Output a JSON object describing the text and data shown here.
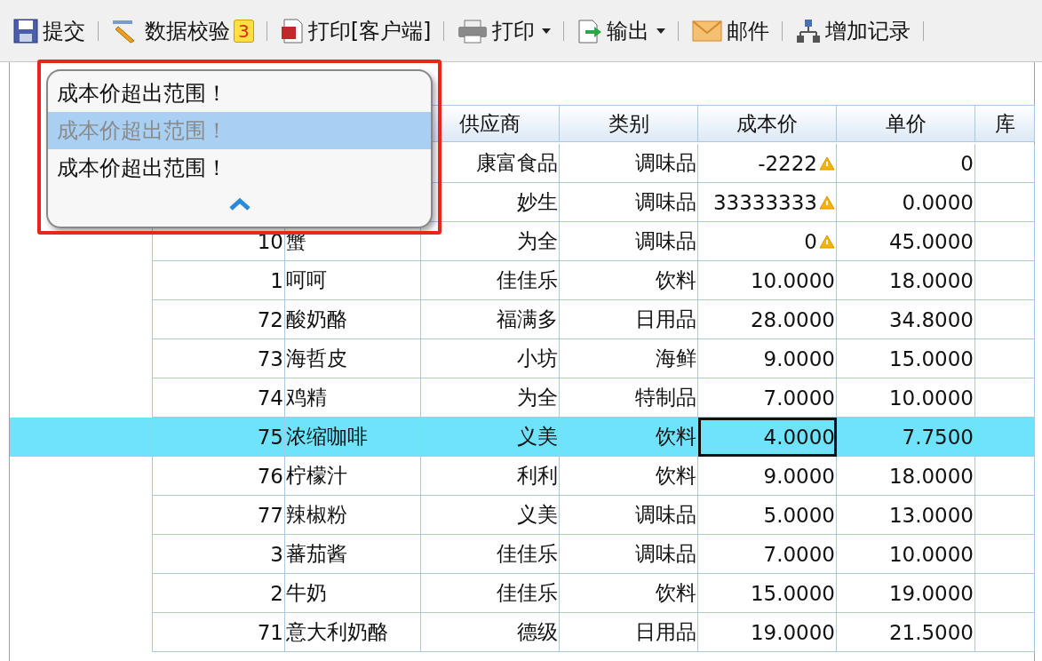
{
  "toolbar": [
    {
      "label": "提交",
      "dropdown": false
    },
    {
      "label": "数据校验",
      "badge": "3",
      "dropdown": false
    },
    {
      "label": "打印[客户端]",
      "dropdown": false
    },
    {
      "label": "打印",
      "dropdown": true
    },
    {
      "label": "输出",
      "dropdown": true
    },
    {
      "label": "邮件",
      "dropdown": false
    },
    {
      "label": "增加记录",
      "dropdown": false
    }
  ],
  "validation_popup": {
    "messages": [
      {
        "text": "成本价超出范围！",
        "selected": false
      },
      {
        "text": "成本价超出范围！",
        "selected": true
      },
      {
        "text": "成本价超出范围！",
        "selected": false
      }
    ]
  },
  "table": {
    "columns": [
      {},
      {},
      {
        "label": "供应商"
      },
      {
        "label": "类别"
      },
      {
        "label": "成本价"
      },
      {
        "label": "单价"
      },
      {
        "label": "库"
      }
    ],
    "rows": [
      {
        "supplier": "康富食品",
        "category": "调味品",
        "cost": "-2222",
        "price": "0",
        "cost_warning": true,
        "cost_focused": false,
        "selected": false
      },
      {
        "supplier": "妙生",
        "category": "调味品",
        "cost": "33333333",
        "price": "0.0000",
        "cost_warning": true,
        "cost_focused": false,
        "selected": false
      },
      {
        "id": "10",
        "name": "蟹",
        "supplier": "为全",
        "category": "调味品",
        "cost": "0",
        "price": "45.0000",
        "cost_warning": true,
        "cost_focused": false,
        "selected": false
      },
      {
        "id": "1",
        "name": "呵呵",
        "supplier": "佳佳乐",
        "category": "饮料",
        "cost": "10.0000",
        "price": "18.0000",
        "cost_warning": false,
        "cost_focused": false,
        "selected": false
      },
      {
        "id": "72",
        "name": "酸奶酪",
        "supplier": "福满多",
        "category": "日用品",
        "cost": "28.0000",
        "price": "34.8000",
        "cost_warning": false,
        "cost_focused": false,
        "selected": false
      },
      {
        "id": "73",
        "name": "海哲皮",
        "supplier": "小坊",
        "category": "海鲜",
        "cost": "9.0000",
        "price": "15.0000",
        "cost_warning": false,
        "cost_focused": false,
        "selected": false
      },
      {
        "id": "74",
        "name": "鸡精",
        "supplier": "为全",
        "category": "特制品",
        "cost": "7.0000",
        "price": "10.0000",
        "cost_warning": false,
        "cost_focused": false,
        "selected": false
      },
      {
        "id": "75",
        "name": "浓缩咖啡",
        "supplier": "义美",
        "category": "饮料",
        "cost": "4.0000",
        "price": "7.7500",
        "cost_warning": false,
        "cost_focused": true,
        "selected": true
      },
      {
        "id": "76",
        "name": "柠檬汁",
        "supplier": "利利",
        "category": "饮料",
        "cost": "9.0000",
        "price": "18.0000",
        "cost_warning": false,
        "cost_focused": false,
        "selected": false
      },
      {
        "id": "77",
        "name": "辣椒粉",
        "supplier": "义美",
        "category": "调味品",
        "cost": "5.0000",
        "price": "13.0000",
        "cost_warning": false,
        "cost_focused": false,
        "selected": false
      },
      {
        "id": "3",
        "name": "蕃茄酱",
        "supplier": "佳佳乐",
        "category": "调味品",
        "cost": "7.0000",
        "price": "10.0000",
        "cost_warning": false,
        "cost_focused": false,
        "selected": false
      },
      {
        "id": "2",
        "name": "牛奶",
        "supplier": "佳佳乐",
        "category": "饮料",
        "cost": "15.0000",
        "price": "19.0000",
        "cost_warning": false,
        "cost_focused": false,
        "selected": false
      },
      {
        "id": "71",
        "name": "意大利奶酪",
        "supplier": "德级",
        "category": "日用品",
        "cost": "19.0000",
        "price": "21.5000",
        "cost_warning": false,
        "cost_focused": false,
        "selected": false
      }
    ]
  }
}
